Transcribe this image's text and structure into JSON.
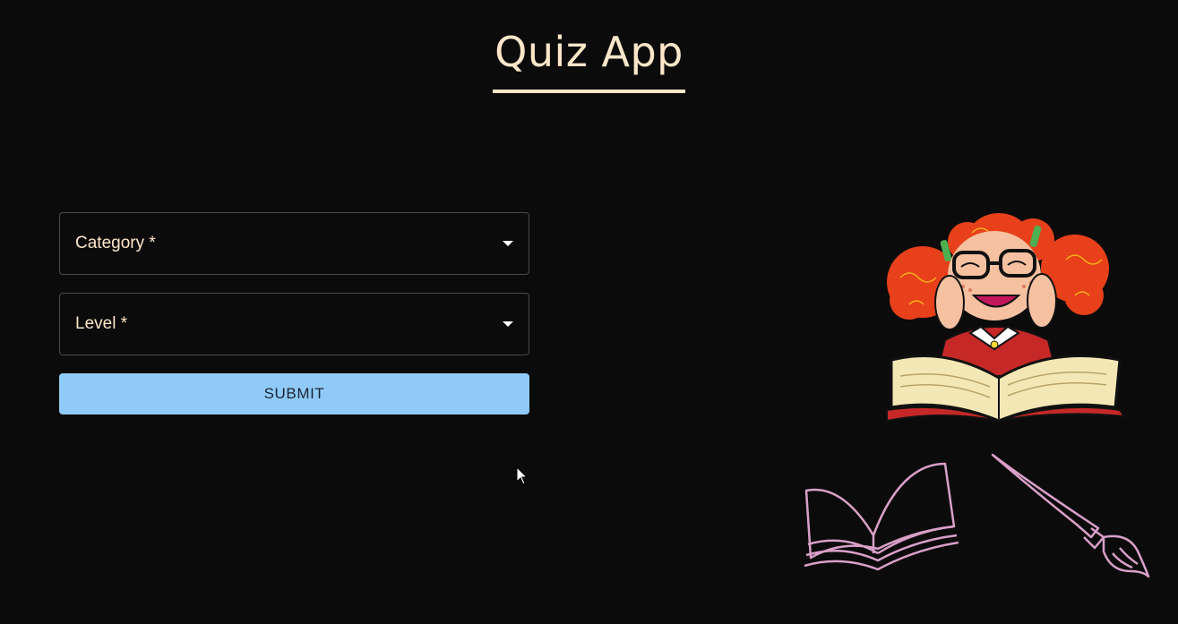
{
  "header": {
    "title": "Quiz App"
  },
  "form": {
    "category_label": "Category *",
    "level_label": "Level *",
    "submit_label": "SUBMIT"
  },
  "colors": {
    "background": "#0b0b0b",
    "title": "#fde6c9",
    "button": "#90caf9",
    "doodles": "#d9a0c8"
  },
  "illustrations": {
    "girl": "girl-reading-book-illustration",
    "book": "open-book-doodle-icon",
    "brush": "paintbrush-doodle-icon"
  }
}
